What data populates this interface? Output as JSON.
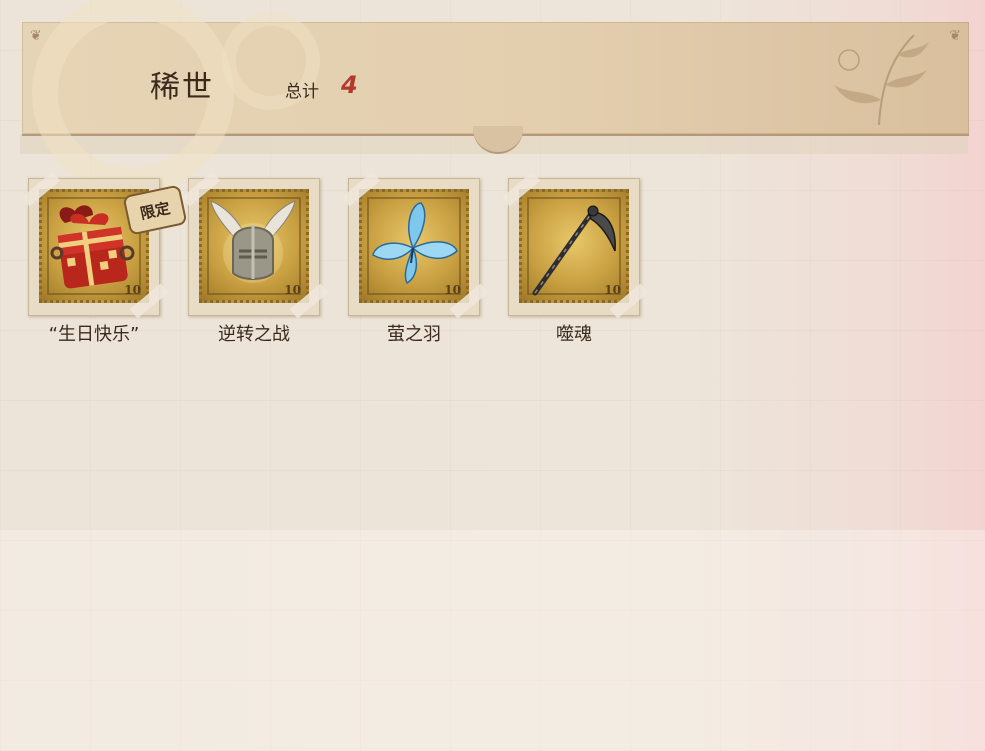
{
  "header": {
    "title": "稀世",
    "total_label": "总计",
    "total_count": "4"
  },
  "items": [
    {
      "name": "“生日快乐”",
      "icon": "gift-box-icon",
      "badge": "限定",
      "stamp_value": "10"
    },
    {
      "name": "逆转之战",
      "icon": "winged-helmet-icon",
      "stamp_value": "10"
    },
    {
      "name": "萤之羽",
      "icon": "blue-butterfly-icon",
      "stamp_value": "10"
    },
    {
      "name": "噬魂",
      "icon": "scythe-icon",
      "stamp_value": "10"
    }
  ],
  "colors": {
    "header_bg": "#e3cfae",
    "count_red": "#b23a2c",
    "stamp_gold": "#c9a042",
    "text_dark": "#3b2a1c"
  }
}
